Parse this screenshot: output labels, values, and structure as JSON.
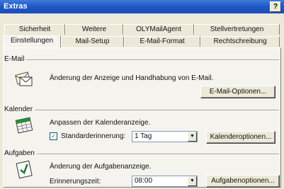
{
  "window": {
    "title": "Extras",
    "help_label": "?"
  },
  "tabs_row1": [
    "Sicherheit",
    "Weitere",
    "OLYMailAgent",
    "Stellvertretungen"
  ],
  "tabs_row2": [
    "Einstellungen",
    "Mail-Setup",
    "E-Mail-Format",
    "Rechtschreibung"
  ],
  "active_tab": "Einstellungen",
  "sections": {
    "email": {
      "label": "E-Mail",
      "description": "Änderung der Anzeige und Handhabung von E-Mail.",
      "button": "E-Mail-Optionen..."
    },
    "calendar": {
      "label": "Kalender",
      "description": "Anpassen der Kalenderanzeige.",
      "reminder_checkbox": "✓",
      "reminder_label": "Standarderinnerung:",
      "reminder_value": "1 Tag",
      "button": "Kalenderoptionen..."
    },
    "tasks": {
      "label": "Aufgaben",
      "description": "Änderung der Aufgabenanzeige.",
      "reminder_time_label": "Erinnerungszeit:",
      "reminder_time_value": "08:00",
      "button": "Aufgabenoptionen..."
    }
  },
  "icons": {
    "email": "envelope-icon",
    "calendar": "calendar-icon",
    "tasks": "checklist-icon"
  }
}
